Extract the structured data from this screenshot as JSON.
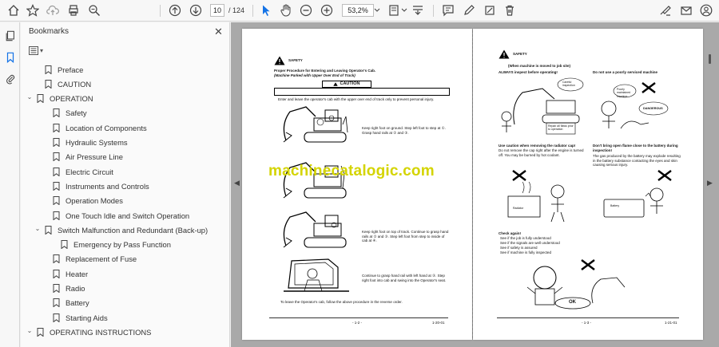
{
  "toolbar": {
    "current_page": "10",
    "total_pages": "/ 124",
    "zoom": "53,2%"
  },
  "panel": {
    "title": "Bookmarks",
    "items": [
      {
        "label": "Preface",
        "level": 1,
        "chevron": ""
      },
      {
        "label": "CAUTION",
        "level": 1,
        "chevron": ""
      },
      {
        "label": "OPERATION",
        "level": 0,
        "chevron": "v"
      },
      {
        "label": "Safety",
        "level": 2,
        "chevron": ""
      },
      {
        "label": "Location of Components",
        "level": 2,
        "chevron": ""
      },
      {
        "label": "Hydraulic Systems",
        "level": 2,
        "chevron": ""
      },
      {
        "label": "Air Pressure Line",
        "level": 2,
        "chevron": ""
      },
      {
        "label": "Electric Circuit",
        "level": 2,
        "chevron": ""
      },
      {
        "label": "Instruments and Controls",
        "level": 2,
        "chevron": ""
      },
      {
        "label": "Operation Modes",
        "level": 2,
        "chevron": ""
      },
      {
        "label": "One Touch Idle and Switch Operation",
        "level": 2,
        "chevron": ""
      },
      {
        "label": "Switch Malfunction and Redundant (Back-up)",
        "level": 1.5,
        "chevron": "v"
      },
      {
        "label": "Emergency by Pass Function",
        "level": 3,
        "chevron": ""
      },
      {
        "label": "Replacement of Fuse",
        "level": 2,
        "chevron": ""
      },
      {
        "label": "Heater",
        "level": 2,
        "chevron": ""
      },
      {
        "label": "Radio",
        "level": 2,
        "chevron": ""
      },
      {
        "label": "Battery",
        "level": 2,
        "chevron": ""
      },
      {
        "label": "Starting Aids",
        "level": 2,
        "chevron": ""
      },
      {
        "label": "OPERATING INSTRUCTIONS",
        "level": 0,
        "chevron": "v"
      }
    ]
  },
  "left_page": {
    "safety": "SAFETY",
    "heading1": "Proper Procedure for Entering and Leaving Operator's Cab.",
    "heading2": "(Machine Parked with Upper Over End of Track)",
    "caution": "CAUTION",
    "caution_text": "Enter and leave the operator's cab with the upper over end of track only to prevent personal injury.",
    "step1": "Keep right foot on ground. Step left foot to step at ①. Grasp hand rails at ② and ③.",
    "step2": "Keep right foot on top of track. Continue to grasp hand rails at ② and ③. Step left foot from step to inside of cab at ④.",
    "step3": "Continue to grasp hand rail with left hand at ③. Step right foot into cab and swing into the Operator's seat.",
    "footer_note": "To leave the Operator's cab, follow the above procedure in the reverse order.",
    "page_no": "- 1-2 -",
    "code": "1-20-01"
  },
  "right_page": {
    "safety": "SAFETY",
    "when_moved": "(When machine is moved to job site)",
    "always_inspect": "ALWAYS inspect before operating!",
    "do_not_use": "Do not use a poorly serviced machine",
    "caption_careful": "Careful inspection",
    "caption_poorly": "Poorly maintained machine",
    "caption_dangerous": "DANGEROUS",
    "caption_repair": "Repair all flaws prior to operation",
    "radiator_head": "Use caution when removing the radiator cap!",
    "radiator_text": "Do not remove the cap right after the engine is turned off. You may be burned by hot coolant.",
    "battery_head": "Don't bring open flame close to the battery during inspection!",
    "battery_text": "The gas produced by the battery may explode resulting in the battery substance contacting the eyes and skin causing serious injury.",
    "radiator_label": "Radiator",
    "battery_label": "Battery",
    "check_again": "Check again!",
    "check1": "See if the job is fully understood",
    "check2": "See if the signals are well understood",
    "check3": "See if safety is assured",
    "check4": "See if machine is fully inspected",
    "ok": "OK",
    "page_no": "- 1-3 -",
    "code": "1-21-01"
  },
  "watermark": "machinecatalogic.com"
}
